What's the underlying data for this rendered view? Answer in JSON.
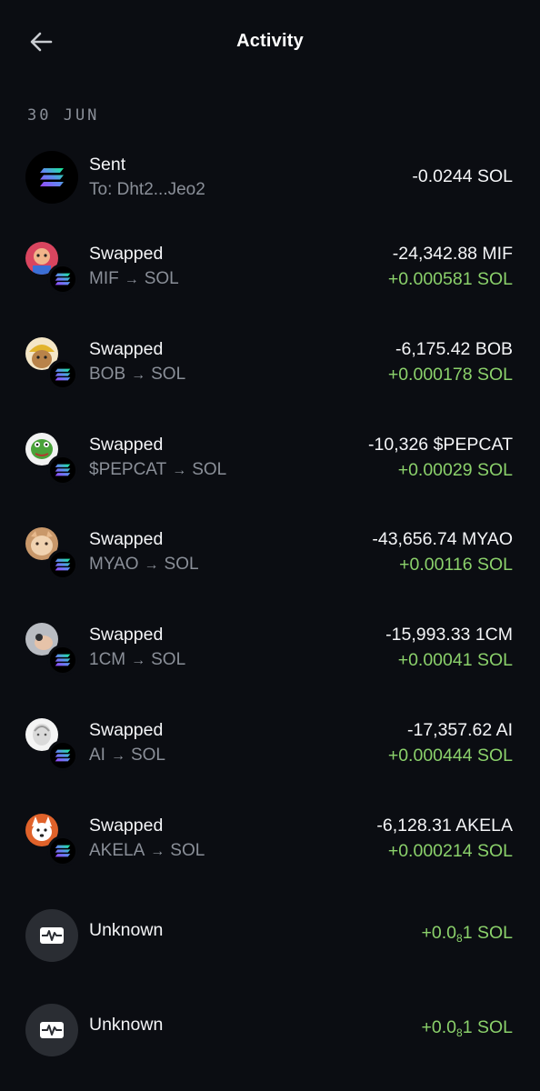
{
  "header": {
    "title": "Activity",
    "back_icon": "arrow-left-icon"
  },
  "date_heading": "30 JUN",
  "colors": {
    "background": "#0b0d12",
    "positive": "#8bd16b",
    "muted": "#8a8f98"
  },
  "transactions": [
    {
      "type": "sent",
      "label": "Sent",
      "sub": "To:  Dht2...Jeo2",
      "amount": "-0.0244 SOL"
    },
    {
      "type": "swap",
      "label": "Swapped",
      "from": "MIF",
      "to": "SOL",
      "amount_out": "-24,342.88 MIF",
      "amount_in": "+0.000581 SOL",
      "token_color": "#d9455f"
    },
    {
      "type": "swap",
      "label": "Swapped",
      "from": "BOB",
      "to": "SOL",
      "amount_out": "-6,175.42 BOB",
      "amount_in": "+0.000178 SOL",
      "token_color": "#e2b42c"
    },
    {
      "type": "swap",
      "label": "Swapped",
      "from": "$PEPCAT",
      "to": "SOL",
      "amount_out": "-10,326 $PEPCAT",
      "amount_in": "+0.00029 SOL",
      "token_color": "#4aa33a"
    },
    {
      "type": "swap",
      "label": "Swapped",
      "from": "MYAO",
      "to": "SOL",
      "amount_out": "-43,656.74 MYAO",
      "amount_in": "+0.00116 SOL",
      "token_color": "#d8a77a"
    },
    {
      "type": "swap",
      "label": "Swapped",
      "from": "1CM",
      "to": "SOL",
      "amount_out": "-15,993.33 1CM",
      "amount_in": "+0.00041 SOL",
      "token_color": "#8e8f93"
    },
    {
      "type": "swap",
      "label": "Swapped",
      "from": "AI",
      "to": "SOL",
      "amount_out": "-17,357.62 AI",
      "amount_in": "+0.000444 SOL",
      "token_color": "#e8e8e8"
    },
    {
      "type": "swap",
      "label": "Swapped",
      "from": "AKELA",
      "to": "SOL",
      "amount_out": "-6,128.31 AKELA",
      "amount_in": "+0.000214 SOL",
      "token_color": "#e0622a"
    },
    {
      "type": "unknown",
      "label": "Unknown",
      "amount_prefix": "+0.0",
      "amount_sub": "8",
      "amount_suffix": "1 SOL"
    },
    {
      "type": "unknown",
      "label": "Unknown",
      "amount_prefix": "+0.0",
      "amount_sub": "8",
      "amount_suffix": "1 SOL"
    }
  ]
}
